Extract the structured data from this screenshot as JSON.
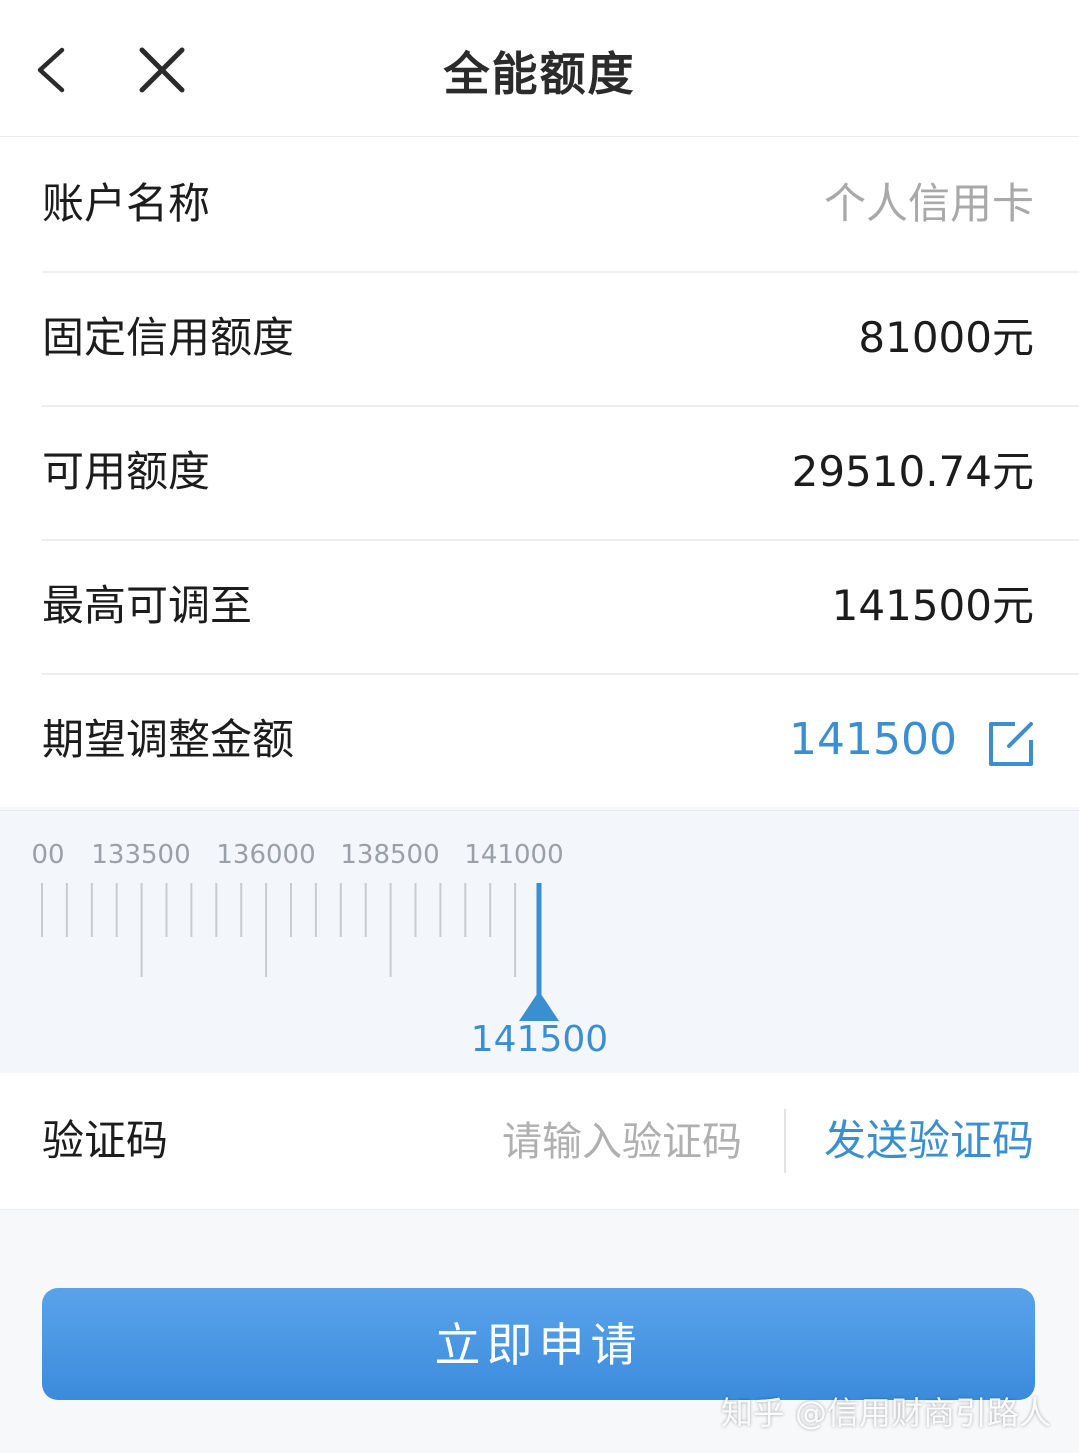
{
  "header": {
    "title": "全能额度"
  },
  "icons": {
    "back": "chevron-left-icon",
    "close": "close-icon",
    "edit": "edit-icon"
  },
  "rows": [
    {
      "label": "账户名称",
      "value": "个人信用卡"
    },
    {
      "label": "固定信用额度",
      "value": "81000元"
    },
    {
      "label": "可用额度",
      "value": "29510.74元"
    },
    {
      "label": "最高可调至",
      "value": "141500元"
    },
    {
      "label": "期望调整金额",
      "value": "141500"
    }
  ],
  "slider": {
    "tick_labels": [
      "00",
      "133500",
      "136000",
      "138500",
      "141000"
    ],
    "selected_value": "141500"
  },
  "captcha": {
    "label": "验证码",
    "placeholder": "请输入验证码",
    "send_label": "发送验证码"
  },
  "apply_label": "立即申请",
  "watermark": "知乎 @信用财商引路人",
  "colors": {
    "accent": "#3b8fd0",
    "button": "#4a97e3"
  }
}
